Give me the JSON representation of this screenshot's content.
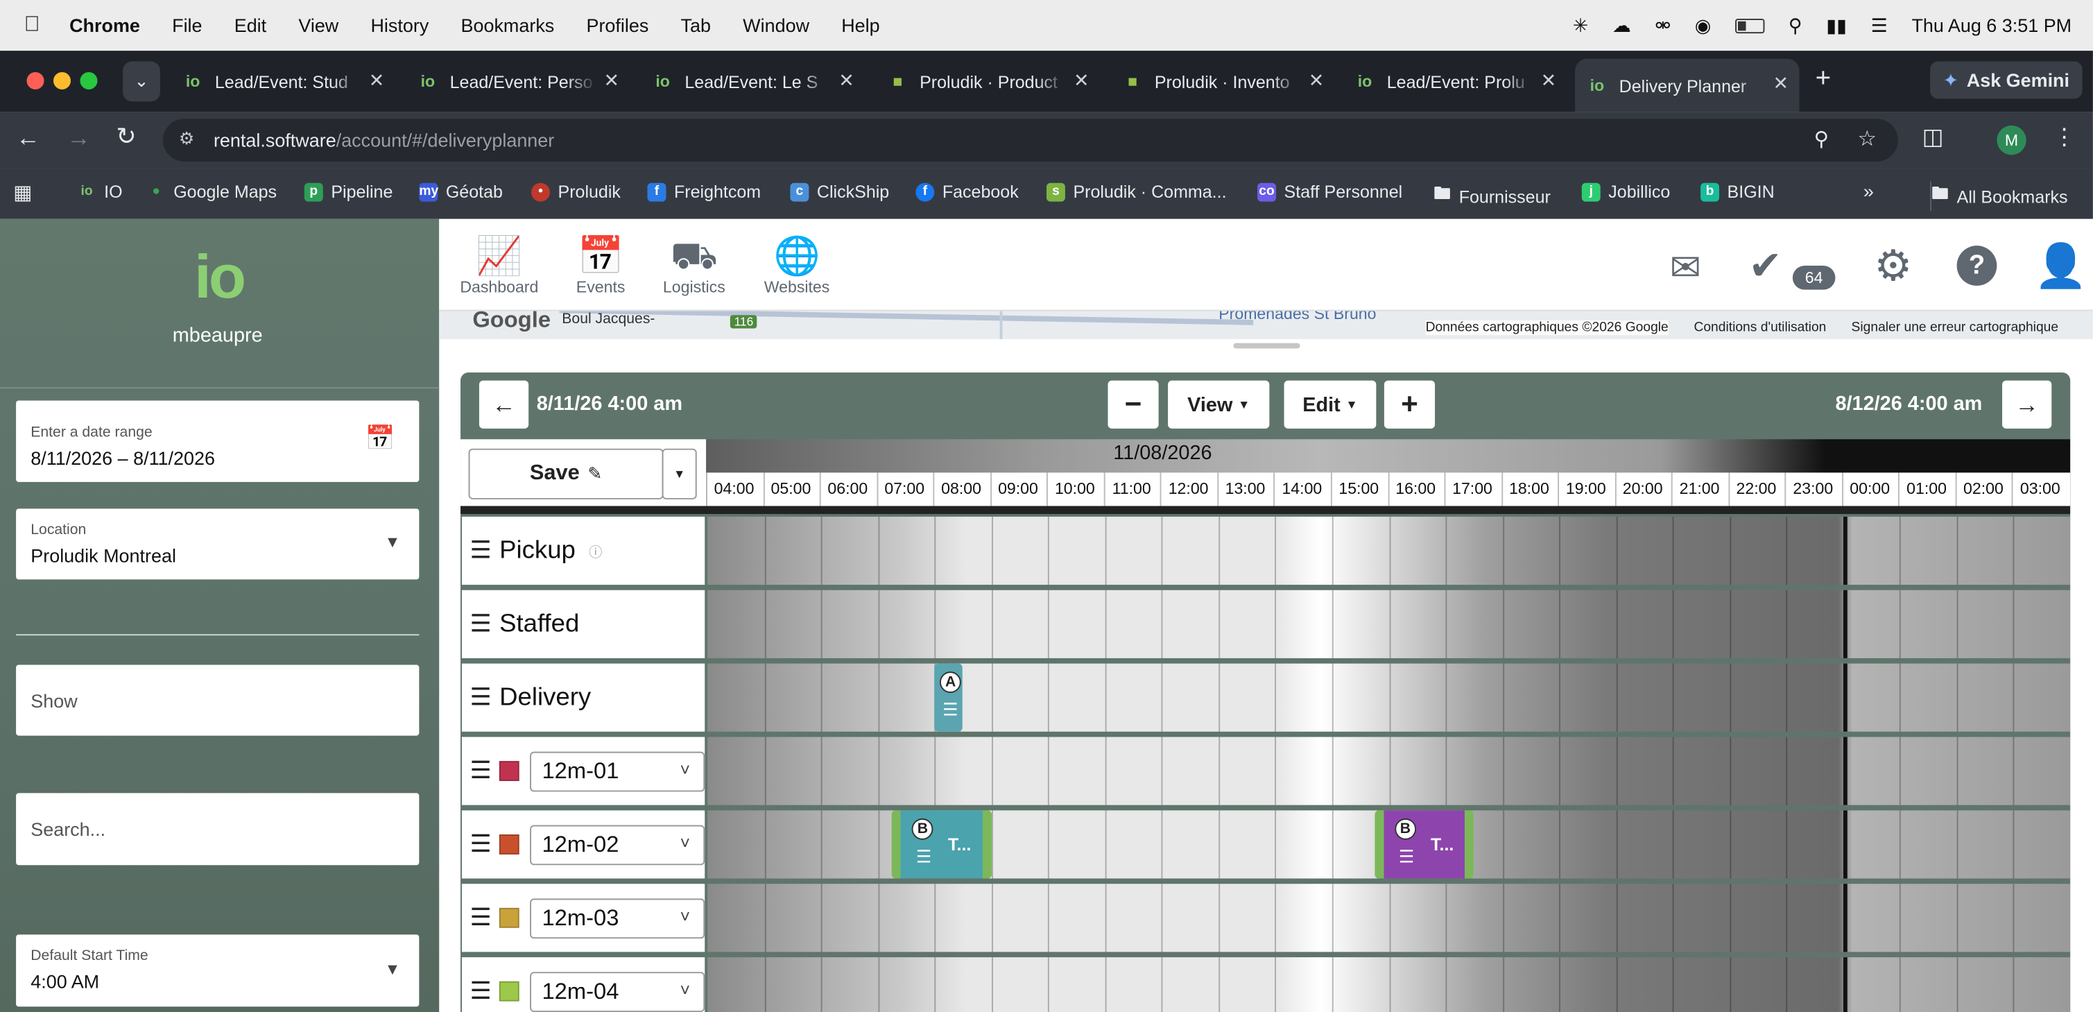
{
  "menubar": {
    "app": "Chrome",
    "items": [
      "File",
      "Edit",
      "View",
      "History",
      "Bookmarks",
      "Profiles",
      "Tab",
      "Window",
      "Help"
    ],
    "clock": "Thu Aug 6  3:51 PM"
  },
  "tabs": [
    {
      "title": "Lead/Event: Stud",
      "icon": "io"
    },
    {
      "title": "Lead/Event: Perso",
      "icon": "io"
    },
    {
      "title": "Lead/Event: Le S",
      "icon": "io"
    },
    {
      "title": "Proludik · Product",
      "icon": "shopify"
    },
    {
      "title": "Proludik · Invento",
      "icon": "shopify"
    },
    {
      "title": "Lead/Event: Prolu",
      "icon": "io"
    },
    {
      "title": "Delivery Planner",
      "icon": "io",
      "active": true
    }
  ],
  "ask_gemini": "Ask Gemini",
  "address": {
    "host": "rental.software",
    "path": "/account/#/deliveryplanner"
  },
  "profile_initial": "M",
  "bookmarks": [
    {
      "label": "IO",
      "color": "#7cc36e"
    },
    {
      "label": "Google Maps",
      "color": "#34a853"
    },
    {
      "label": "Pipeline",
      "color": "#2e9e57"
    },
    {
      "label": "Géotab",
      "color": "#3b5bdb"
    },
    {
      "label": "Proludik",
      "color": "#c0392b"
    },
    {
      "label": "Freightcom",
      "color": "#2c7be5"
    },
    {
      "label": "ClickShip",
      "color": "#4a90d9"
    },
    {
      "label": "Facebook",
      "color": "#1877f2"
    },
    {
      "label": "Proludik · Comma...",
      "color": "#7cb342"
    },
    {
      "label": "Staff Personnel",
      "color": "#6c5ce7"
    },
    {
      "label": "Fournisseur",
      "color": "#9aa0a6"
    },
    {
      "label": "Jobillico",
      "color": "#2ecc71"
    },
    {
      "label": "BIGIN",
      "color": "#1abc9c"
    }
  ],
  "all_bookmarks": "All Bookmarks",
  "sidebar": {
    "logo": "io",
    "username": "mbeaupre",
    "date_range": {
      "label": "Enter a date range",
      "value": "8/11/2026 – 8/11/2026"
    },
    "location": {
      "label": "Location",
      "value": "Proludik Montreal"
    },
    "show_placeholder": "Show",
    "search_placeholder": "Search...",
    "start_time": {
      "label": "Default Start Time",
      "value": "4:00 AM"
    }
  },
  "nav": {
    "items": [
      {
        "label": "Dashboard",
        "icon": "chart-icon"
      },
      {
        "label": "Events",
        "icon": "calendar-icon"
      },
      {
        "label": "Logistics",
        "icon": "truck-icon"
      },
      {
        "label": "Websites",
        "icon": "globe-icon"
      }
    ],
    "task_count": "64"
  },
  "map": {
    "google": "Google",
    "street": "Boul Jacques-",
    "route": "116",
    "place": "Promenades St Bruno",
    "attribution": "Données cartographiques ©2026 Google",
    "terms": "Conditions d'utilisation",
    "report": "Signaler une erreur cartographique"
  },
  "planner": {
    "start": "8/11/26 4:00 am",
    "end": "8/12/26 4:00 am",
    "view_label": "View",
    "edit_label": "Edit",
    "save_label": "Save",
    "date_header": "11/08/2026",
    "hours": [
      "04:00",
      "05:00",
      "06:00",
      "07:00",
      "08:00",
      "09:00",
      "10:00",
      "11:00",
      "12:00",
      "13:00",
      "14:00",
      "15:00",
      "16:00",
      "17:00",
      "18:00",
      "19:00",
      "20:00",
      "21:00",
      "22:00",
      "23:00",
      "00:00",
      "01:00",
      "02:00",
      "03:00"
    ],
    "rows": [
      {
        "type": "group",
        "label": "Pickup",
        "info": true
      },
      {
        "type": "group",
        "label": "Staffed"
      },
      {
        "type": "group",
        "label": "Delivery"
      },
      {
        "type": "vehicle",
        "label": "12m-01",
        "color": "#c0334f"
      },
      {
        "type": "vehicle",
        "label": "12m-02",
        "color": "#c8502d"
      },
      {
        "type": "vehicle",
        "label": "12m-03",
        "color": "#c9a23a"
      },
      {
        "type": "vehicle",
        "label": "12m-04",
        "color": "#9cc94a"
      }
    ],
    "events": [
      {
        "row": 2,
        "start_hour": 8.0,
        "end_hour": 8.5,
        "badge": "A",
        "label": "",
        "color": "#5aa5b0"
      },
      {
        "row": 4,
        "start_hour": 7.25,
        "end_hour": 9.0,
        "badge": "B",
        "label": "T...",
        "color": "#4aa3ad"
      },
      {
        "row": 4,
        "start_hour": 15.75,
        "end_hour": 17.5,
        "badge": "B",
        "label": "T...",
        "color": "#8e44ad"
      }
    ]
  }
}
